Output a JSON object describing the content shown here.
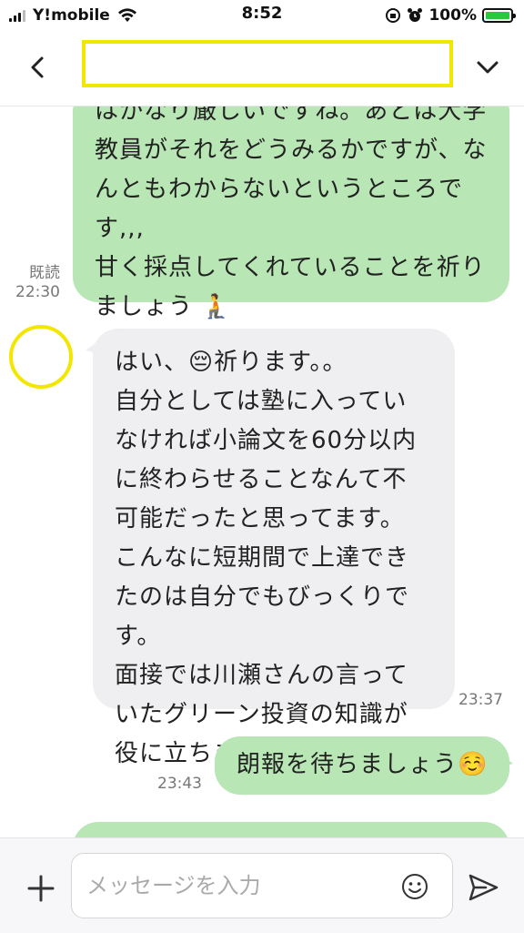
{
  "status_bar": {
    "carrier": "Y!mobile",
    "time": "8:52",
    "battery_percent": "100%",
    "battery_level": 1.0
  },
  "header": {
    "title": "",
    "icons": {
      "back": "chevron-left-icon",
      "menu": "chevron-down-icon"
    }
  },
  "messages": [
    {
      "side": "right",
      "lines": [
        "はかなり厳しいですね。あとは大学",
        "教員がそれをどうみるかですが、な",
        "んともわからないというところで",
        "す,,,",
        "甘く採点してくれていることを祈り",
        "ましょう 🧎"
      ],
      "read_label": "既読",
      "time": "22:30"
    },
    {
      "side": "left",
      "lines": [
        "はい、😔祈ります。。",
        "自分としては塾に入ってい",
        "なければ小論文を60分以内",
        "に終わらせることなんて不",
        "可能だったと思ってます。",
        "こんなに短期間で上達でき",
        "たのは自分でもびっくりで",
        "す。",
        "面接では川瀬さんの言って",
        "いたグリーン投資の知識が",
        "役に立ちました！"
      ],
      "time": "23:37"
    },
    {
      "side": "right",
      "lines": [
        "朗報を待ちましょう☺️"
      ],
      "time": "23:43"
    },
    {
      "side": "right",
      "lines": [
        ""
      ],
      "time": ""
    }
  ],
  "input": {
    "placeholder": "メッセージを入力",
    "value": ""
  },
  "colors": {
    "own_bubble": "#b8e6b4",
    "other_bubble": "#efeff1",
    "highlight": "#f3e600",
    "battery": "#2bc73f"
  }
}
